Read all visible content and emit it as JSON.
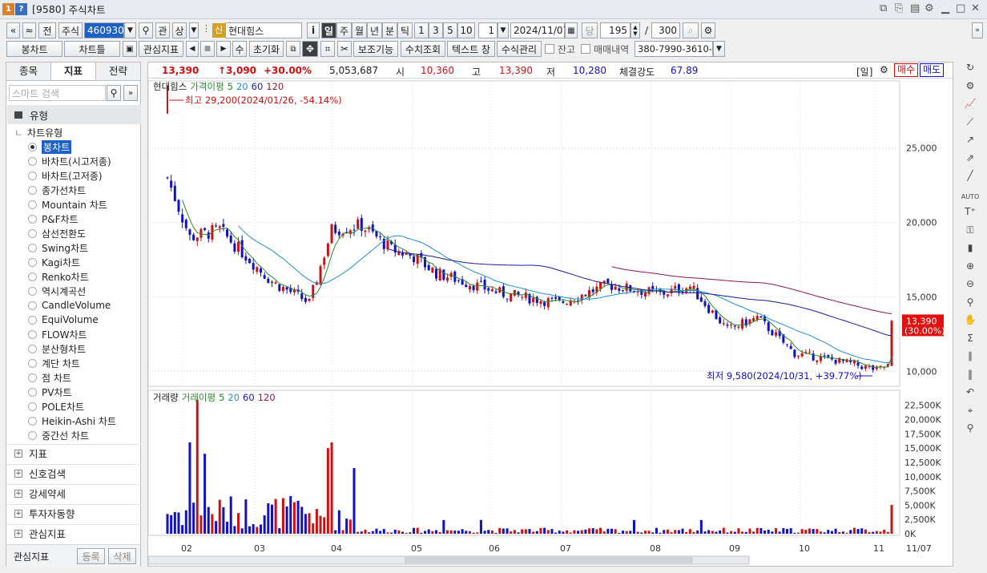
{
  "window": {
    "code": "[9580]",
    "title": "주식차트"
  },
  "toolbar1": {
    "prev": "«",
    "up": "≈",
    "jeon": "전",
    "market": "주식",
    "code": "460930",
    "gwan": "관",
    "sang": "상",
    "sin": "신",
    "stock_name": "현대힘스",
    "i": "i",
    "periods": [
      "일",
      "주",
      "월",
      "년",
      "분",
      "틱"
    ],
    "nums": [
      "1",
      "3",
      "5",
      "10"
    ],
    "unit": "1",
    "date": "2024/11/07",
    "dang": "당",
    "count": "195",
    "slash": "/",
    "total": "300"
  },
  "toolbar2": {
    "chart_type": "봉차트",
    "chart_frame": "차트틀",
    "interest": "관심지표",
    "su": "수",
    "reset": "초기화",
    "aux": "보조기능",
    "numeric": "수치조회",
    "text_window": "텍스트 창",
    "formula": "수식관리",
    "balance": "잔고",
    "trades": "매매내역",
    "account": "380-7990-3610-1"
  },
  "side": {
    "tabs": [
      "종목",
      "지표",
      "전략"
    ],
    "search_placeholder": "스마트 검색",
    "group_type": "유형",
    "chart_type_label": "차트유형",
    "chart_types": [
      "봉차트",
      "바차트(시고저종)",
      "바차트(고저종)",
      "종가선차트",
      "Mountain 차트",
      "P&F차트",
      "삼선전환도",
      "Swing차트",
      "Kagi차트",
      "Renko차트",
      "역시계곡선",
      "CandleVolume",
      "EquiVolume",
      "FLOW차트",
      "분산형차트",
      "계단 차트",
      "점 차트",
      "PV차트",
      "POLE차트",
      "Heikin-Ashi 차트",
      "중간선 차트"
    ],
    "groups": [
      "지표",
      "신호검색",
      "강세약세",
      "투자자동향",
      "관심지표"
    ],
    "footer_label": "관심지표",
    "register": "등록",
    "delete": "삭제"
  },
  "quote": {
    "price": "13,390",
    "change": "↑3,090",
    "rate": "+30.00%",
    "volume": "5,053,687",
    "open_label": "시",
    "open": "10,360",
    "high_label": "고",
    "high": "13,390",
    "low_label": "저",
    "low": "10,280",
    "strength_label": "체결강도",
    "strength": "67.89",
    "period": "[일]",
    "buy": "매수",
    "sell": "매도"
  },
  "legend_price": {
    "name": "현대힘스",
    "ma": "가격이평",
    "items": [
      "5",
      "20",
      "60",
      "120"
    ]
  },
  "legend_volume": {
    "name": "거래량",
    "ma": "거래이평",
    "items": [
      "5",
      "20",
      "60",
      "120"
    ]
  },
  "annotations": {
    "high": "최고 29,200(2024/01/26, -54.14%)",
    "low": "최저 9,580(2024/10/31, +39.77%)"
  },
  "price_axis": [
    "25,000",
    "20,000",
    "15,000",
    "10,000"
  ],
  "price_tag": [
    "13,390",
    "(30.00%)"
  ],
  "volume_axis": [
    "22,500K",
    "20,000K",
    "17,500K",
    "15,000K",
    "12,500K",
    "10,000K",
    "7,500K",
    "5,000K",
    "2,500K",
    "0K"
  ],
  "x_axis": [
    "02",
    "03",
    "04",
    "05",
    "06",
    "07",
    "08",
    "09",
    "10",
    "11"
  ],
  "x_last": "11/07",
  "colors": {
    "up": "#d01010",
    "down": "#1010c8",
    "ma5": "#2a8a2a",
    "ma20": "#1e90d0",
    "ma60": "#1a1a9a",
    "ma120": "#8a1a3a"
  }
}
